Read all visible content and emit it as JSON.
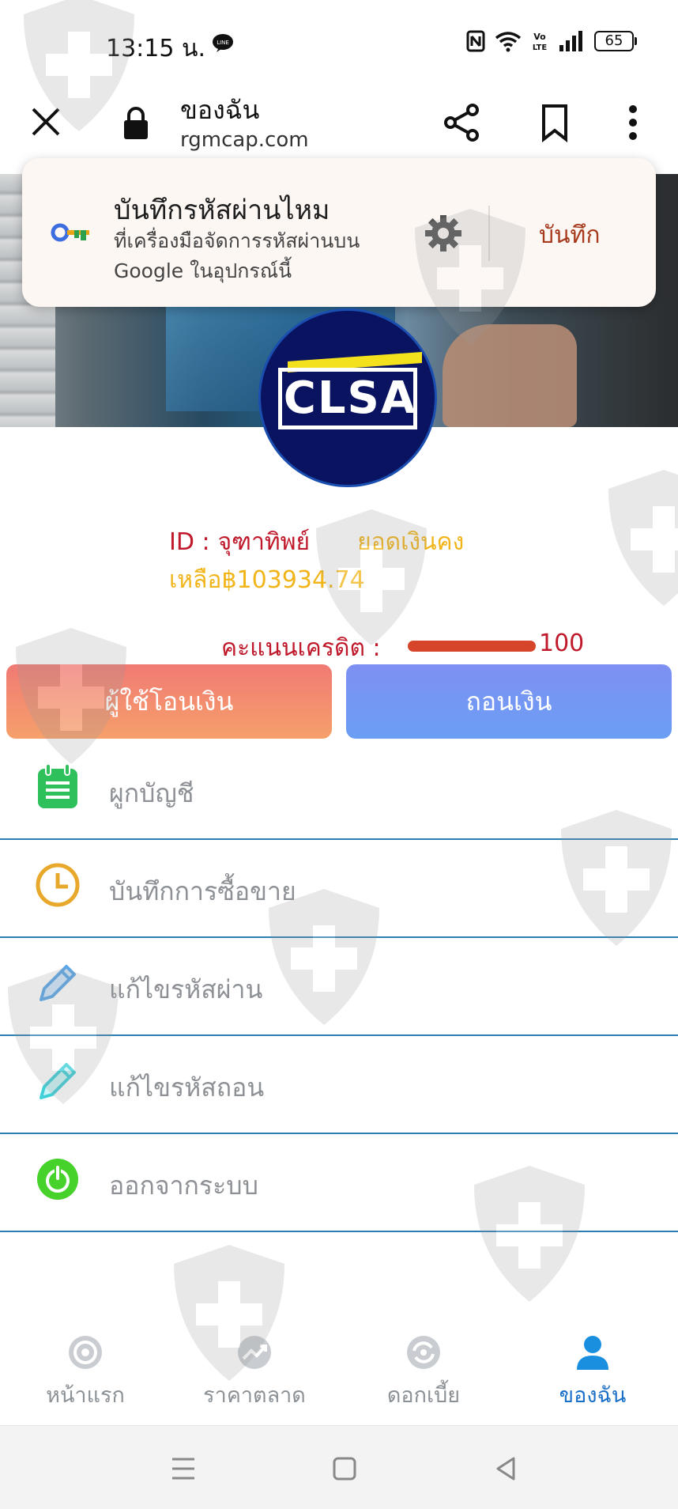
{
  "status_bar": {
    "time": "13:15 น.",
    "battery": "65"
  },
  "browser": {
    "page_title": "ของฉัน",
    "url": "rgmcap.com"
  },
  "password_prompt": {
    "title": "บันทึกรหัสผ่านไหม",
    "description": "ที่เครื่องมือจัดการรหัสผ่านบน Google ในอุปกรณ์นี้",
    "save_label": "บันทึก"
  },
  "logo": {
    "text": "CLSA"
  },
  "account": {
    "id_label": "ID :",
    "name": "จุฑาทิพย์",
    "balance_label": "ยอดเงินคงเหลือ",
    "balance_value": "฿103934.74",
    "credit_label": "คะแนนเครดิต :",
    "credit_value": "100"
  },
  "actions": {
    "transfer_label": "ผู้ใช้โอนเงิน",
    "withdraw_label": "ถอนเงิน"
  },
  "menu": [
    {
      "label": "ผูกบัญชี",
      "icon": "clipboard-icon",
      "color": "#2ec05a"
    },
    {
      "label": "บันทึกการซื้อขาย",
      "icon": "clock-icon",
      "color": "#e8a82b"
    },
    {
      "label": "แก้ไขรหัสผ่าน",
      "icon": "pencil-icon",
      "color": "#5aa6e8"
    },
    {
      "label": "แก้ไขรหัสถอน",
      "icon": "pencil-icon",
      "color": "#3fd0d8"
    },
    {
      "label": "ออกจากระบบ",
      "icon": "power-icon",
      "color": "#46d12b"
    }
  ],
  "bottom_nav": [
    {
      "label": "หน้าแรก",
      "icon": "home-icon",
      "active": false
    },
    {
      "label": "ราคาตลาด",
      "icon": "market-icon",
      "active": false
    },
    {
      "label": "ดอกเบี้ย",
      "icon": "interest-icon",
      "active": false
    },
    {
      "label": "ของฉัน",
      "icon": "profile-icon",
      "active": true
    }
  ],
  "colors": {
    "accent": "#1a6fc8",
    "red_text": "#c0192b",
    "gold_text": "#f1b51a",
    "divider": "#2c7eb0"
  }
}
